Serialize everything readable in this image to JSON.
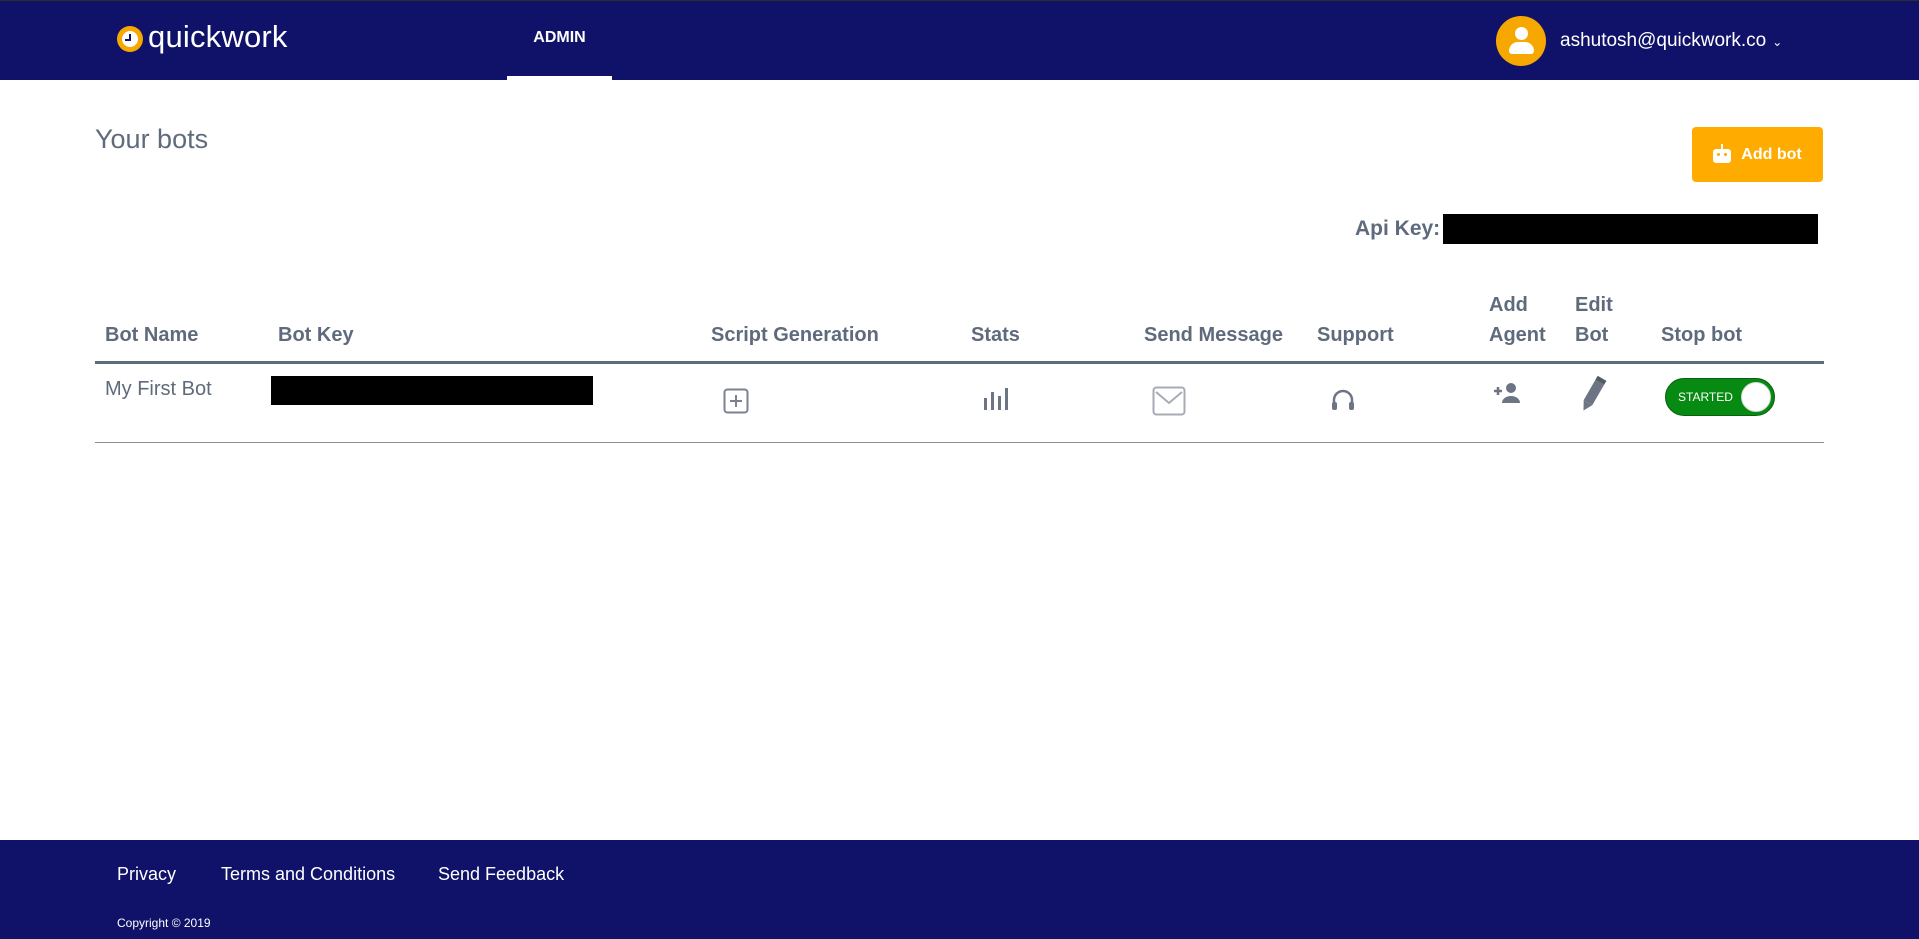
{
  "header": {
    "logo_text": "quickwork",
    "nav_tab": "ADMIN",
    "user_email": "ashutosh@quickwork.co"
  },
  "page": {
    "title": "Your bots",
    "add_bot_label": "Add bot",
    "api_key_label": "Api Key:"
  },
  "table": {
    "headers": {
      "bot_name": "Bot Name",
      "bot_key": "Bot Key",
      "script_generation": "Script Generation",
      "stats": "Stats",
      "send_message": "Send Message",
      "support": "Support",
      "add_agent_line1": "Add",
      "add_agent_line2": "Agent",
      "edit_bot_line1": "Edit",
      "edit_bot_line2": "Bot",
      "stop_bot": "Stop bot"
    },
    "rows": [
      {
        "bot_name": "My First Bot",
        "status": "STARTED"
      }
    ]
  },
  "icons": {
    "script_generation": "plus-square-icon",
    "stats": "bar-chart-icon",
    "send_message": "envelope-icon",
    "support": "headset-icon",
    "add_agent": "add-user-icon",
    "edit_bot": "pencil-icon"
  },
  "footer": {
    "privacy": "Privacy",
    "terms": "Terms and Conditions",
    "feedback": "Send Feedback",
    "copyright": "Copyright © 2019"
  },
  "colors": {
    "navbar": "#0f1268",
    "accent": "#ffab00",
    "toggle_on": "#068a12",
    "text": "#5f6b7c"
  }
}
